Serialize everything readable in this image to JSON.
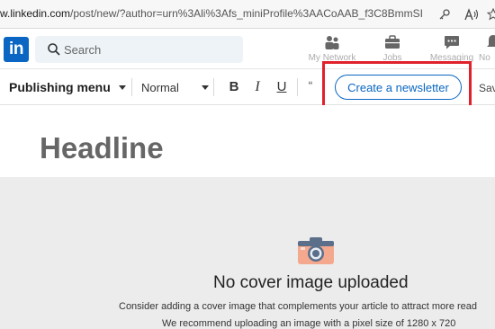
{
  "browser": {
    "url_host": "w.linkedin.com",
    "url_path": "/post/new/?author=urn%3Ali%3Afs_miniProfile%3AACoAAB_f3C8BmmSIME4...",
    "icons": [
      "key-icon",
      "read-aloud-icon",
      "favorites-star-icon"
    ]
  },
  "nav": {
    "logo": "in",
    "search_placeholder": "Search",
    "items": [
      {
        "label": "My Network",
        "icon": "people-icon"
      },
      {
        "label": "Jobs",
        "icon": "briefcase-icon"
      },
      {
        "label": "Messaging",
        "icon": "chat-icon"
      },
      {
        "label": "No",
        "icon": "bell-icon"
      }
    ]
  },
  "toolbar": {
    "publishing_menu": "Publishing menu",
    "text_style": "Normal",
    "bold": "B",
    "italic": "I",
    "underline": "U",
    "quote": "“",
    "create_newsletter": "Create a newsletter",
    "save": "Sav"
  },
  "editor": {
    "headline_placeholder": "Headline"
  },
  "cover": {
    "title": "No cover image uploaded",
    "line1": "Consider adding a cover image that complements your article to attract more read",
    "line2": "We recommend uploading an image with a pixel size of 1280 x 720"
  },
  "colors": {
    "brand": "#0a66c2",
    "highlight": "#e0202a",
    "cover_bg": "#ececec"
  }
}
